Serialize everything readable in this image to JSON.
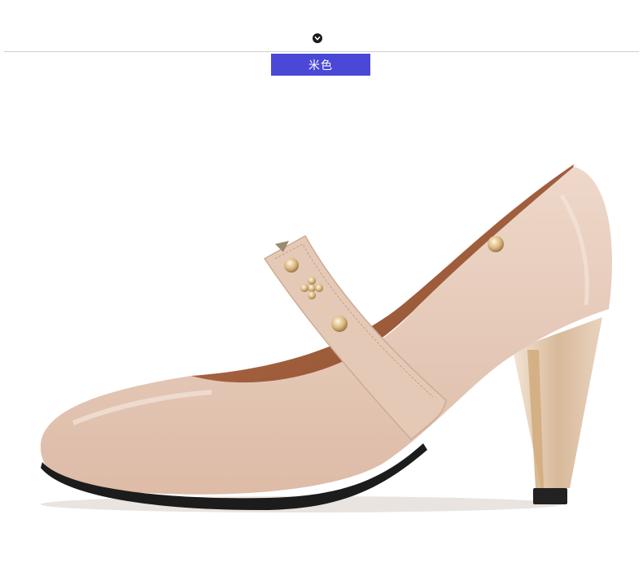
{
  "color_tag": {
    "label": "米色"
  },
  "icons": {
    "badge": "chevron-down-icon"
  },
  "colors": {
    "tag_bg": "#4a48d6",
    "shoe_leather": "#e8cdbd",
    "shoe_lining": "#9c5a3a",
    "heel_metal": "#c9a77a"
  }
}
